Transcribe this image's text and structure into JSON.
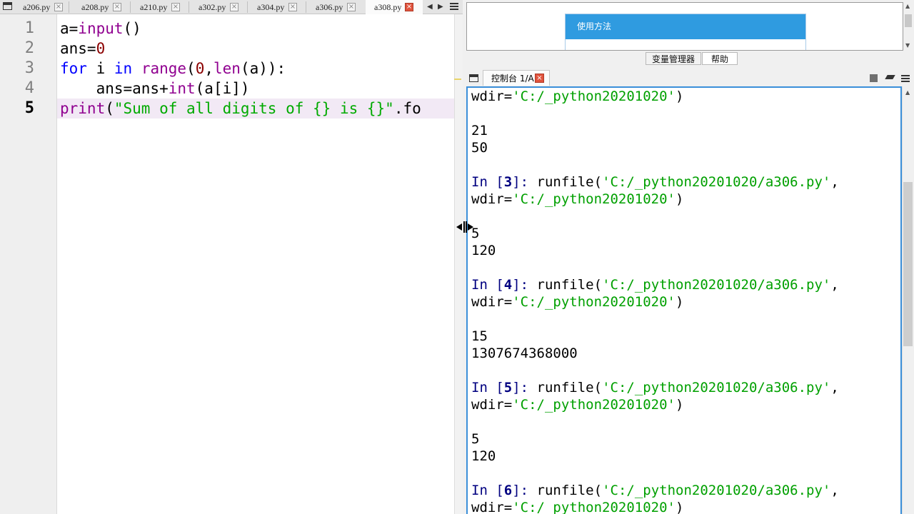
{
  "editor": {
    "tabs": [
      {
        "label": "a206.py",
        "active": false
      },
      {
        "label": "a208.py",
        "active": false
      },
      {
        "label": "a210.py",
        "active": false
      },
      {
        "label": "a302.py",
        "active": false
      },
      {
        "label": "a304.py",
        "active": false
      },
      {
        "label": "a306.py",
        "active": false
      },
      {
        "label": "a308.py",
        "active": true
      }
    ],
    "close_glyph": "×",
    "line_numbers": [
      "1",
      "2",
      "3",
      "4",
      "5"
    ],
    "current_line": "5",
    "code": {
      "l1": {
        "a": "a=",
        "b": "input",
        "c": "()"
      },
      "l2": {
        "a": "ans=",
        "b": "0"
      },
      "l3": {
        "kw1": "for",
        "a": " i ",
        "kw2": "in",
        "b": " ",
        "fn1": "range",
        "c": "(",
        "n": "0",
        "d": ",",
        "fn2": "len",
        "e": "(a)):"
      },
      "l4": {
        "a": "    ans=ans+",
        "fn": "int",
        "b": "(a[i])"
      },
      "l5": {
        "fn": "print",
        "a": "(",
        "s": "\"Sum of all digits of {} is {}\"",
        "b": ".fo"
      }
    }
  },
  "help": {
    "card_title": "使用方法",
    "tabs": [
      {
        "label": "变量管理器",
        "active": false
      },
      {
        "label": "帮助",
        "active": true
      }
    ]
  },
  "console": {
    "tab_label": "控制台 1/A",
    "lines": {
      "l0": {
        "a": "wdir=",
        "s": "'C:/_python20201020'",
        "b": ")"
      },
      "o1": "21",
      "o2": "50",
      "p3": {
        "pre": "In [",
        "n": "3",
        "post": "]: ",
        "a": "runfile(",
        "s1": "'C:/_python20201020/a306.py'",
        "b": ","
      },
      "w3": {
        "a": "wdir=",
        "s": "'C:/_python20201020'",
        "b": ")"
      },
      "o3a": "5",
      "o3b": "120",
      "p4": {
        "pre": "In [",
        "n": "4",
        "post": "]: ",
        "a": "runfile(",
        "s1": "'C:/_python20201020/a306.py'",
        "b": ","
      },
      "w4": {
        "a": "wdir=",
        "s": "'C:/_python20201020'",
        "b": ")"
      },
      "o4a": "15",
      "o4b": "1307674368000",
      "p5": {
        "pre": "In [",
        "n": "5",
        "post": "]: ",
        "a": "runfile(",
        "s1": "'C:/_python20201020/a306.py'",
        "b": ","
      },
      "w5": {
        "a": "wdir=",
        "s": "'C:/_python20201020'",
        "b": ")"
      },
      "o5a": "5",
      "o5b": "120",
      "p6": {
        "pre": "In [",
        "n": "6",
        "post": "]: ",
        "a": "runfile(",
        "s1": "'C:/_python20201020/a306.py'",
        "b": ","
      },
      "w6": {
        "a": "wdir=",
        "s": "'C:/_python20201020'",
        "b": ")"
      }
    }
  },
  "colors": {
    "console_border": "#3b8fd9",
    "help_header": "#2f9be0",
    "close_active": "#e0533d",
    "keyword": "#0000ff",
    "builtin": "#900090",
    "string": "#00aa00"
  }
}
